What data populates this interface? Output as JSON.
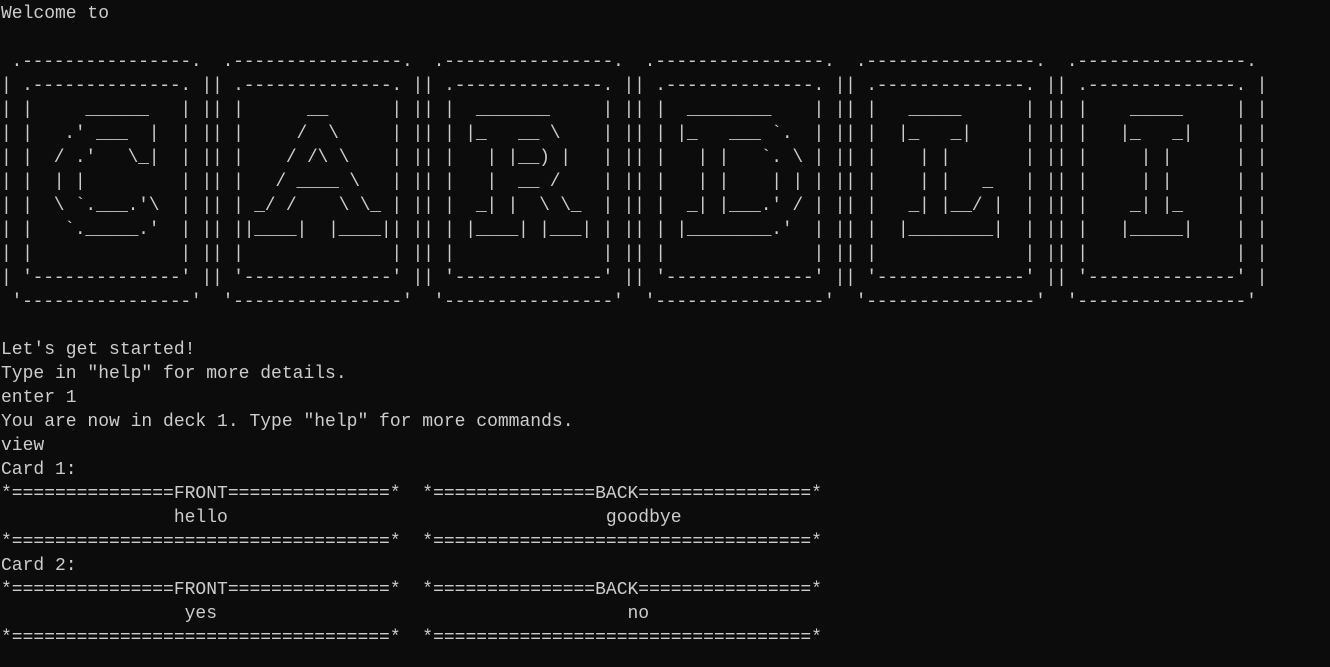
{
  "terminal": {
    "welcome": "Welcome to",
    "banner": [
      " .----------------.  .----------------.  .----------------.  .----------------.  .----------------.  .----------------. ",
      "| .--------------. || .--------------. || .--------------. || .--------------. || .--------------. || .--------------. |",
      "| |     ______   | || |      __      | || |  _______     | || |  ________    | || |   _____      | || |    _____     | |",
      "| |   .' ___  |  | || |     /  \\     | || | |_   __ \\    | || | |_   ___ `.  | || |  |_   _|     | || |   |_   _|    | |",
      "| |  / .'   \\_|  | || |    / /\\ \\    | || |   | |__) |   | || |   | |   `. \\ | || |    | |       | || |     | |      | |",
      "| |  | |         | || |   / ____ \\   | || |   |  __ /    | || |   | |    | | | || |    | |   _   | || |     | |      | |",
      "| |  \\ `.___.'\\  | || | _/ /    \\ \\_ | || |  _| |  \\ \\_  | || |  _| |___.' / | || |   _| |__/ |  | || |    _| |_     | |",
      "| |   `._____.'  | || ||____|  |____|| || | |____| |___| | || | |________.'  | || |  |________|  | || |   |_____|    | |",
      "| |              | || |              | || |              | || |              | || |              | || |              | |",
      "| '--------------' || '--------------' || '--------------' || '--------------' || '--------------' || '--------------' |",
      " '----------------'  '----------------'  '----------------'  '----------------'  '----------------'  '----------------' "
    ],
    "lines": {
      "started": "Let's get started!",
      "help_hint": "Type in \"help\" for more details.",
      "cmd_enter": "enter 1",
      "deck_msg": "You are now in deck 1. Type \"help\" for more commands.",
      "cmd_view": "view"
    },
    "cards": [
      {
        "label": "Card 1:",
        "header": "*===============FRONT===============*  *===============BACK================*",
        "content": "                hello                                   goodbye",
        "footer": "*===================================*  *===================================*"
      },
      {
        "label": "Card 2:",
        "header": "*===============FRONT===============*  *===============BACK================*",
        "content": "                 yes                                      no",
        "footer": "*===================================*  *===================================*"
      }
    ],
    "colors": {
      "background": "#0c0c0c",
      "text": "#cccccc"
    }
  }
}
